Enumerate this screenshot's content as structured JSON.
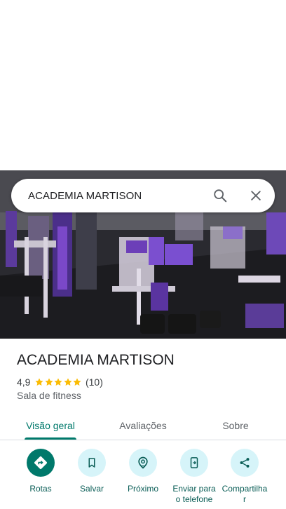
{
  "search": {
    "query": "ACADEMIA MARTISON"
  },
  "place": {
    "name": "ACADEMIA MARTISON",
    "rating": "4,9",
    "stars": 5,
    "review_count": "(10)",
    "category": "Sala de fitness"
  },
  "tabs": [
    {
      "label": "Visão geral",
      "active": true
    },
    {
      "label": "Avaliações",
      "active": false
    },
    {
      "label": "Sobre",
      "active": false
    }
  ],
  "actions": [
    {
      "label": "Rotas",
      "icon": "directions-icon"
    },
    {
      "label": "Salvar",
      "icon": "bookmark-icon"
    },
    {
      "label": "Próximo",
      "icon": "nearby-icon"
    },
    {
      "label": "Enviar para o telefone",
      "icon": "send-to-phone-icon"
    },
    {
      "label": "Compartilhar",
      "icon": "share-icon"
    }
  ],
  "colors": {
    "accent": "#00796b",
    "star": "#fbbc04",
    "action_bg": "#d6f4f9"
  }
}
